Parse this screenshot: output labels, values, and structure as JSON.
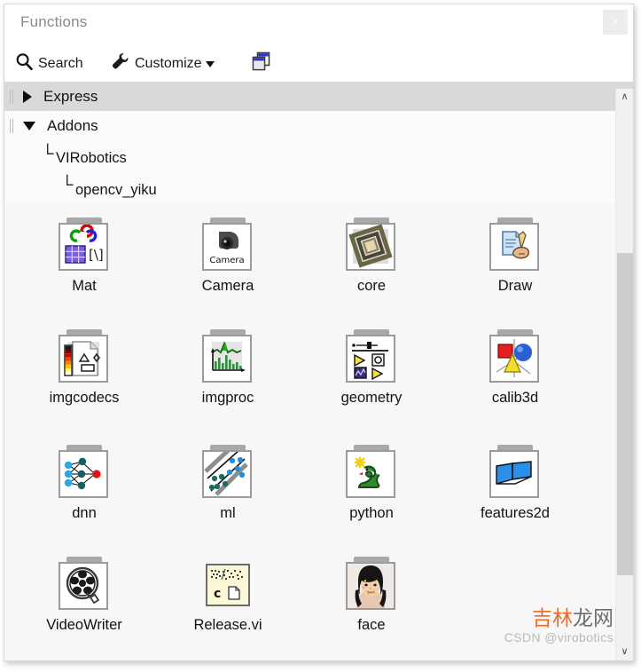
{
  "window": {
    "title": "Functions",
    "close_label": "×",
    "close_icon": "close-icon"
  },
  "toolbar": {
    "search_label": "Search",
    "search_icon": "search-magnifier-icon",
    "customize_label": "Customize",
    "customize_icon": "wrench-icon",
    "customize_caret": "chevron-down-icon",
    "window_icon": "restore-windows-icon"
  },
  "tree": {
    "rows": [
      {
        "label": "Express",
        "state": "collapsed",
        "arrow_icon": "triangle-right-icon",
        "selected": true
      },
      {
        "label": "Addons",
        "state": "expanded",
        "arrow_icon": "triangle-down-icon",
        "selected": false
      }
    ],
    "subrows": [
      {
        "label": "VIRobotics",
        "elbow": "└",
        "depth": 1
      },
      {
        "label": "opencv_yiku",
        "elbow": "└",
        "depth": 2
      }
    ]
  },
  "palette": {
    "items": [
      {
        "label": "Mat",
        "kind": "folder",
        "icon": "mat-matrix-icon"
      },
      {
        "label": "Camera",
        "kind": "folder",
        "icon": "camera-icon"
      },
      {
        "label": "core",
        "kind": "folder",
        "icon": "core-frame-icon"
      },
      {
        "label": "Draw",
        "kind": "folder",
        "icon": "draw-hand-pen-icon"
      },
      {
        "label": "imgcodecs",
        "kind": "folder",
        "icon": "imgcodecs-document-icon"
      },
      {
        "label": "imgproc",
        "kind": "folder",
        "icon": "imgproc-histogram-icon"
      },
      {
        "label": "geometry",
        "kind": "folder",
        "icon": "geometry-palette-icon"
      },
      {
        "label": "calib3d",
        "kind": "folder",
        "icon": "calib3d-shapes-icon"
      },
      {
        "label": "dnn",
        "kind": "folder",
        "icon": "dnn-network-icon"
      },
      {
        "label": "ml",
        "kind": "folder",
        "icon": "ml-scatter-icon"
      },
      {
        "label": "python",
        "kind": "folder",
        "icon": "python-snake-icon"
      },
      {
        "label": "features2d",
        "kind": "folder",
        "icon": "features2d-planes-icon"
      },
      {
        "label": "VideoWriter",
        "kind": "folder",
        "icon": "film-reel-icon"
      },
      {
        "label": "Release.vi",
        "kind": "vi",
        "icon": "release-vi-icon"
      },
      {
        "label": "face",
        "kind": "folder",
        "icon": "face-portrait-icon"
      }
    ]
  },
  "scrollbar": {
    "up_arrow": "∧",
    "down_arrow": "∨",
    "up_icon": "chevron-up-icon",
    "down_icon": "chevron-down-icon"
  },
  "watermark": {
    "cn_orange": "吉林",
    "cn_gray": "龙网",
    "en": "CSDN @virobotics"
  },
  "colors": {
    "window_bg": "#f7f7f7",
    "titlebar_bg": "#ffffff",
    "selected_row": "#d9d9d9",
    "scrollbar_thumb": "#cdcdcd",
    "watermark_orange": "#f06a24",
    "label_text": "#121212"
  }
}
